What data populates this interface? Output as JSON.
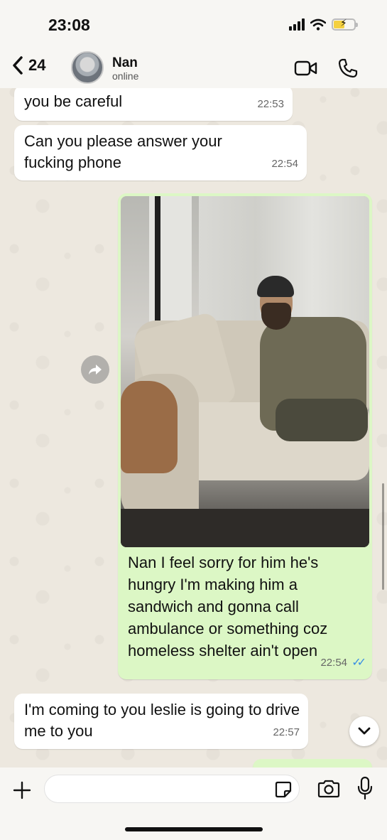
{
  "status_bar": {
    "time": "23:08"
  },
  "header": {
    "back_count": "24",
    "contact_name": "Nan",
    "contact_status": "online"
  },
  "messages": [
    {
      "direction": "incoming",
      "text": "you be careful",
      "time": "22:53"
    },
    {
      "direction": "incoming",
      "text": "Can you please answer your fucking phone",
      "time": "22:54"
    },
    {
      "direction": "outgoing",
      "type": "photo",
      "caption": "Nan I feel sorry for him he's hungry I'm making him a sandwich and gonna call ambulance or something coz homeless shelter ain't open",
      "time": "22:54",
      "status": "read"
    },
    {
      "direction": "incoming",
      "text": "I'm coming to you leslie is going to drive me to you",
      "time": "22:57"
    }
  ],
  "input": {
    "placeholder": "",
    "value": ""
  },
  "colors": {
    "outgoing_bubble": "#dcf7c5",
    "incoming_bubble": "#ffffff",
    "read_ticks": "#3a8fe4",
    "battery_charging": "#f4d03f"
  },
  "icons": [
    "back-chevron-icon",
    "video-call-icon",
    "phone-call-icon",
    "forward-icon",
    "chevron-down-icon",
    "plus-icon",
    "sticker-icon",
    "camera-icon",
    "microphone-icon"
  ]
}
